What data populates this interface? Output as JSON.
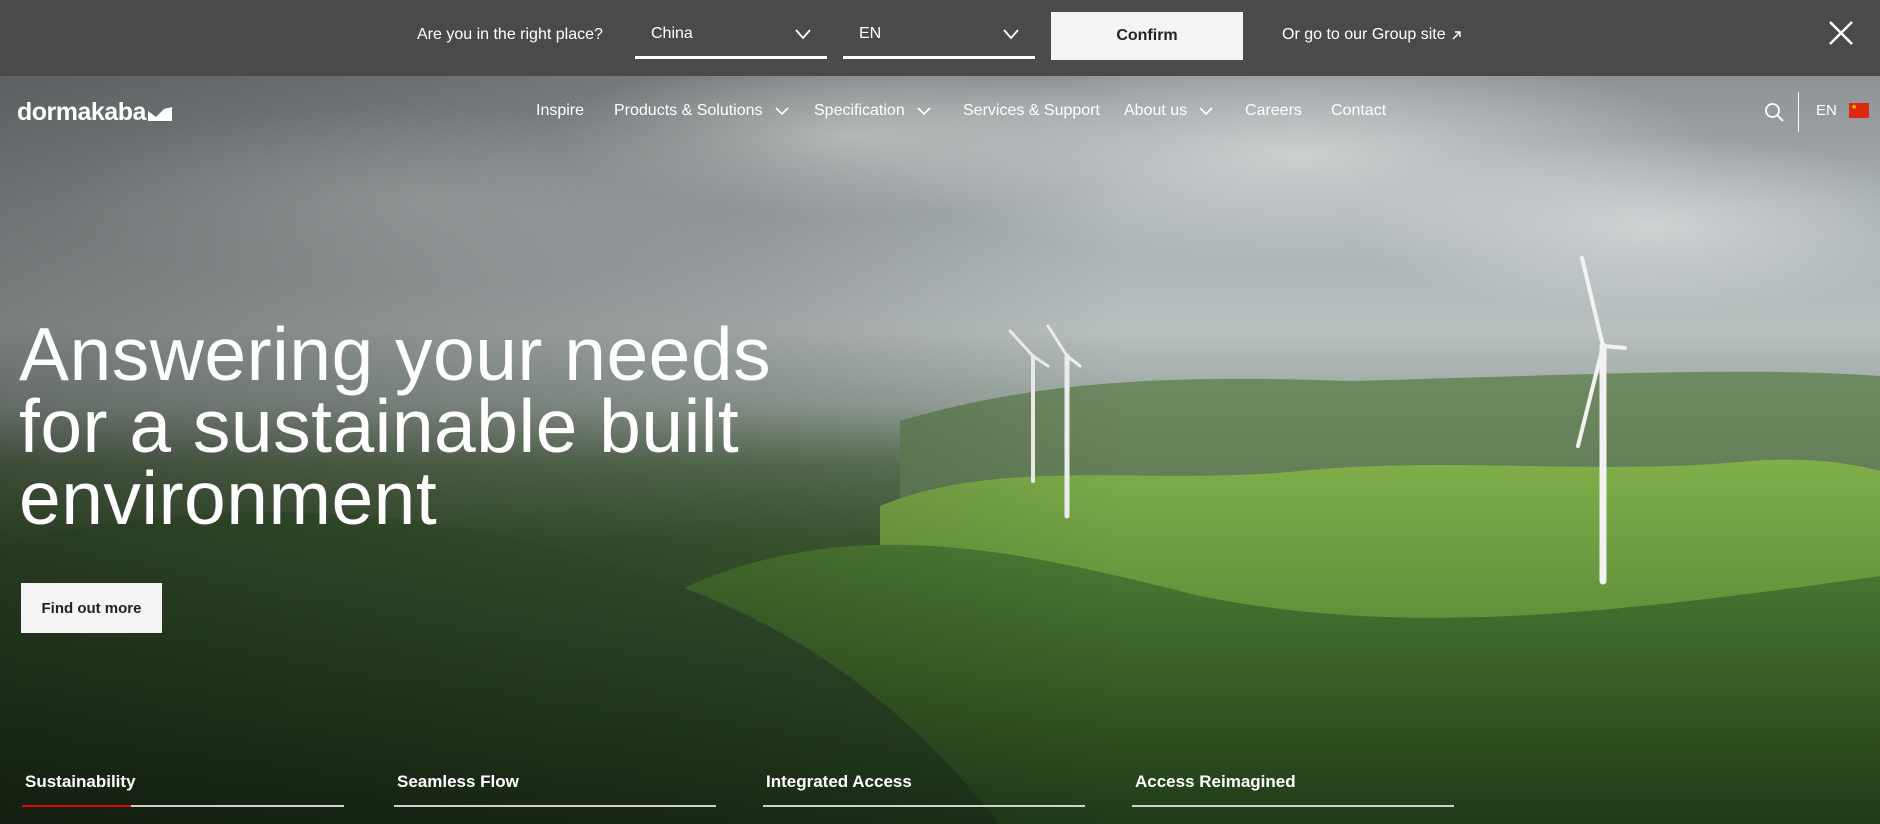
{
  "location_bar": {
    "question": "Are you in the right place?",
    "country_select": {
      "value": "China"
    },
    "language_select": {
      "value": "EN"
    },
    "confirm_label": "Confirm",
    "group_link_label": "Or go to our Group site",
    "close_icon": "close-icon"
  },
  "nav": {
    "logo": "dormakaba",
    "items": [
      {
        "label": "Inspire",
        "has_dropdown": false
      },
      {
        "label": "Products & Solutions",
        "has_dropdown": true
      },
      {
        "label": "Specification",
        "has_dropdown": true
      },
      {
        "label": "Services & Support",
        "has_dropdown": false
      },
      {
        "label": "About us",
        "has_dropdown": true
      },
      {
        "label": "Careers",
        "has_dropdown": false
      },
      {
        "label": "Contact",
        "has_dropdown": false
      }
    ],
    "search_icon": "search-icon",
    "language": "EN",
    "flag_icon": "china-flag-icon"
  },
  "hero": {
    "headline_lines": [
      "Answering your needs",
      "for a sustainable built",
      "environment"
    ],
    "cta_label": "Find out more"
  },
  "tabs": [
    {
      "label": "Sustainability",
      "active": true,
      "progress": 0.34
    },
    {
      "label": "Seamless Flow",
      "active": false,
      "progress": 0
    },
    {
      "label": "Integrated Access",
      "active": false,
      "progress": 0
    },
    {
      "label": "Access Reimagined",
      "active": false,
      "progress": 0
    }
  ],
  "colors": {
    "location_bar_bg": "#4a4a4a",
    "button_bg": "#f4f4f4",
    "accent_red": "#e30613"
  }
}
